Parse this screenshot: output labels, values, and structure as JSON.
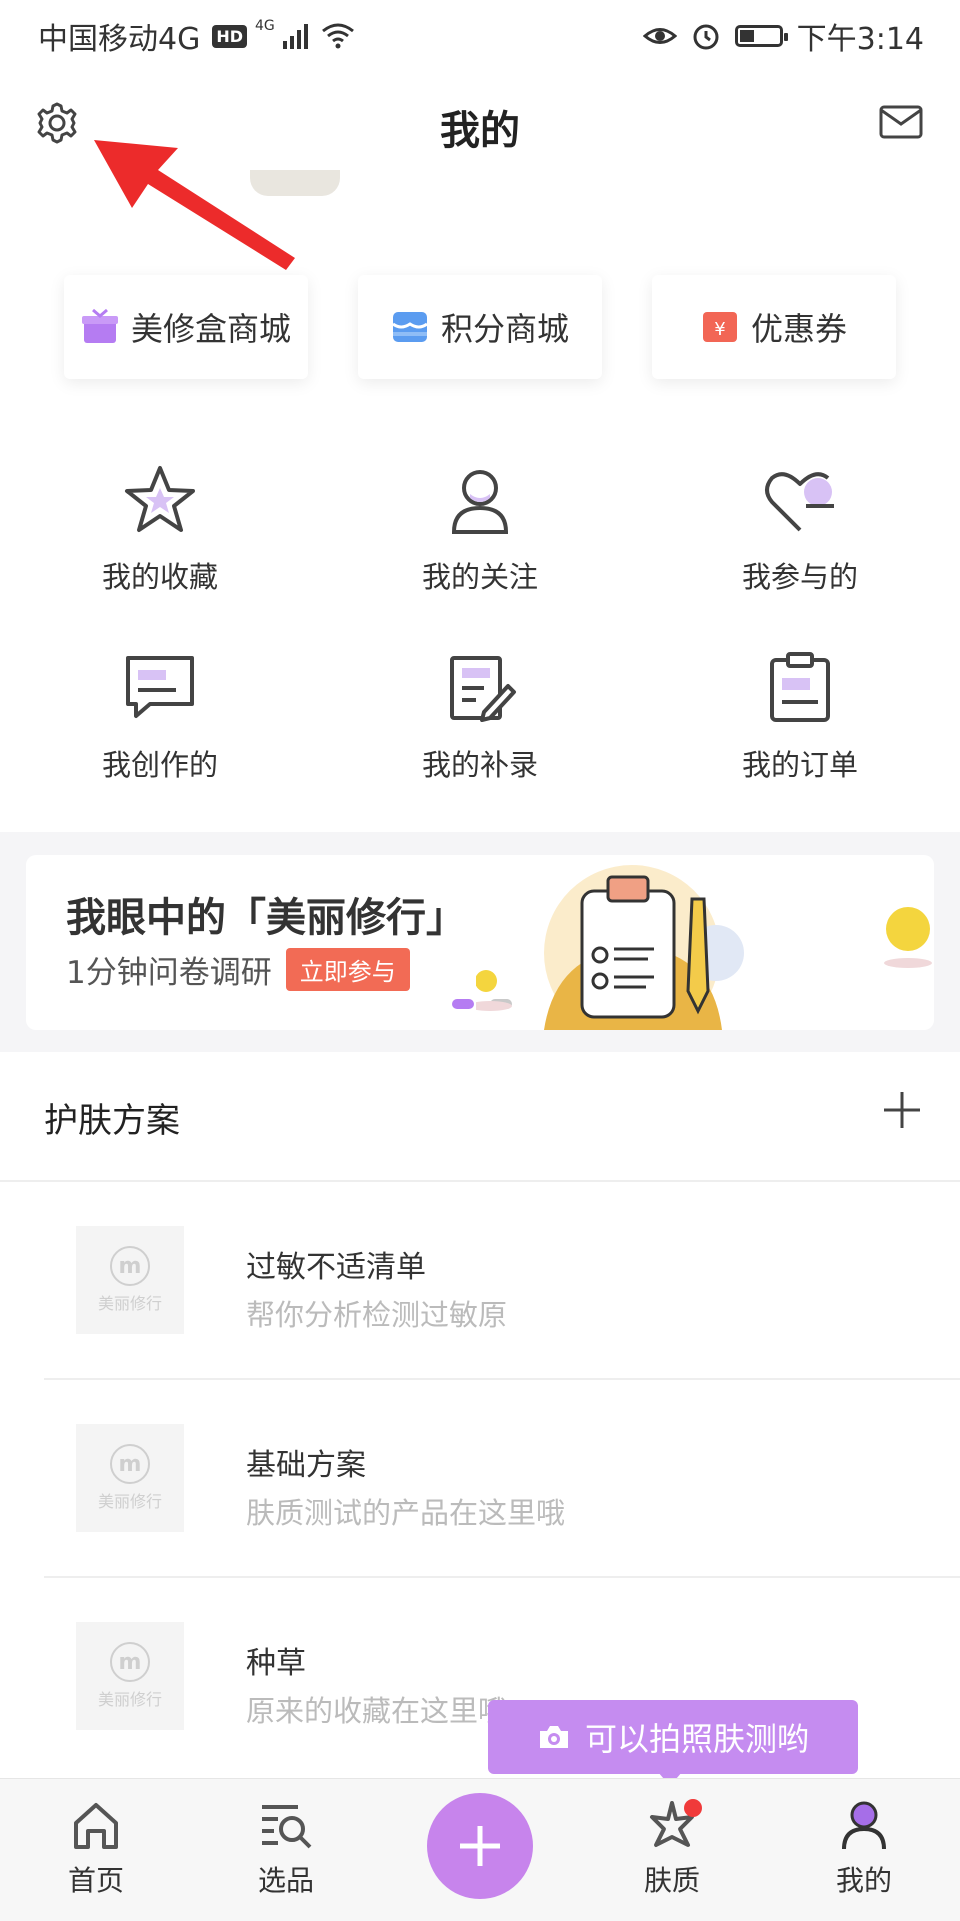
{
  "status_bar": {
    "carrier": "中国移动4G",
    "hd": "HD",
    "network": "4G",
    "time": "下午3:14"
  },
  "header": {
    "title": "我的",
    "settings_icon": "gear-icon",
    "mail_icon": "mail-icon"
  },
  "quick_cards": [
    {
      "label": "美修盒商城",
      "icon": "gift-box-icon",
      "color": "#b57cf2"
    },
    {
      "label": "积分商城",
      "icon": "store-icon",
      "color": "#5b9cf0"
    },
    {
      "label": "优惠券",
      "icon": "coupon-icon",
      "color": "#f26655"
    }
  ],
  "grid": [
    {
      "label": "我的收藏",
      "icon": "star-icon"
    },
    {
      "label": "我的关注",
      "icon": "person-icon"
    },
    {
      "label": "我参与的",
      "icon": "heart-chat-icon"
    },
    {
      "label": "我创作的",
      "icon": "message-icon"
    },
    {
      "label": "我的补录",
      "icon": "edit-note-icon"
    },
    {
      "label": "我的订单",
      "icon": "clipboard-icon"
    }
  ],
  "banner": {
    "title": "我眼中的「美丽修行」",
    "subtitle": "1分钟问卷调研",
    "badge": "立即参与",
    "active_dot_color": "#b57cf2"
  },
  "section": {
    "title": "护肤方案",
    "add_icon": "plus-icon"
  },
  "plans": [
    {
      "name": "过敏不适清单",
      "desc": "帮你分析检测过敏原",
      "thumb_text": "美丽修行",
      "thumb_logo": "m"
    },
    {
      "name": "基础方案",
      "desc": "肤质测试的产品在这里哦",
      "thumb_text": "美丽修行",
      "thumb_logo": "m"
    },
    {
      "name": "种草",
      "desc": "原来的收藏在这里哦",
      "thumb_text": "美丽修行",
      "thumb_logo": "m"
    }
  ],
  "tooltip": {
    "text": "可以拍照肤测哟",
    "icon": "camera-icon"
  },
  "bottom_nav": [
    {
      "label": "首页",
      "icon": "home-icon"
    },
    {
      "label": "选品",
      "icon": "search-list-icon"
    },
    {
      "label": "",
      "icon": "plus-icon"
    },
    {
      "label": "肤质",
      "icon": "sparkle-icon"
    },
    {
      "label": "我的",
      "icon": "user-icon"
    }
  ],
  "accent_color": "#c784ec"
}
